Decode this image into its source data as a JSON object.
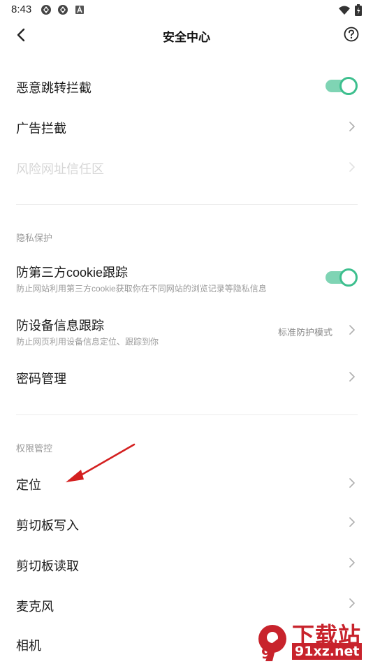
{
  "status_bar": {
    "time": "8:43",
    "left_icons": [
      "app-notification-icon",
      "app-notification-icon",
      "font-a-icon"
    ],
    "right_icons": [
      "wifi-icon",
      "battery-charging-icon"
    ]
  },
  "nav": {
    "title": "安全中心",
    "back_icon": "back-arrow-icon",
    "help_icon": "help-circle-icon"
  },
  "colors": {
    "accent": "#3dbf8e",
    "toggle_track": "#7fd4b4",
    "watermark_red": "#c8232c",
    "annotation_red": "#d42020"
  },
  "general": {
    "malicious_redirect": {
      "label": "恶意跳转拦截",
      "enabled": true
    },
    "ad_block": {
      "label": "广告拦截"
    },
    "risky_url_trust": {
      "label": "风险网址信任区",
      "disabled": true
    }
  },
  "privacy": {
    "section_label": "隐私保护",
    "third_party_cookie": {
      "label": "防第三方cookie跟踪",
      "description": "防止网站利用第三方cookie获取你在不同网站的浏览记录等隐私信息",
      "enabled": true
    },
    "device_tracking": {
      "label": "防设备信息跟踪",
      "description": "防止网页利用设备信息定位、跟踪到你",
      "value": "标准防护模式"
    },
    "password_manager": {
      "label": "密码管理"
    }
  },
  "permissions": {
    "section_label": "权限管控",
    "location": {
      "label": "定位"
    },
    "clipboard_write": {
      "label": "剪切板写入"
    },
    "clipboard_read": {
      "label": "剪切板读取"
    },
    "microphone": {
      "label": "麦克风"
    },
    "camera": {
      "label": "相机"
    }
  },
  "watermark": {
    "brand": "下载站",
    "url": "91xz.net",
    "logo_text": "9"
  }
}
